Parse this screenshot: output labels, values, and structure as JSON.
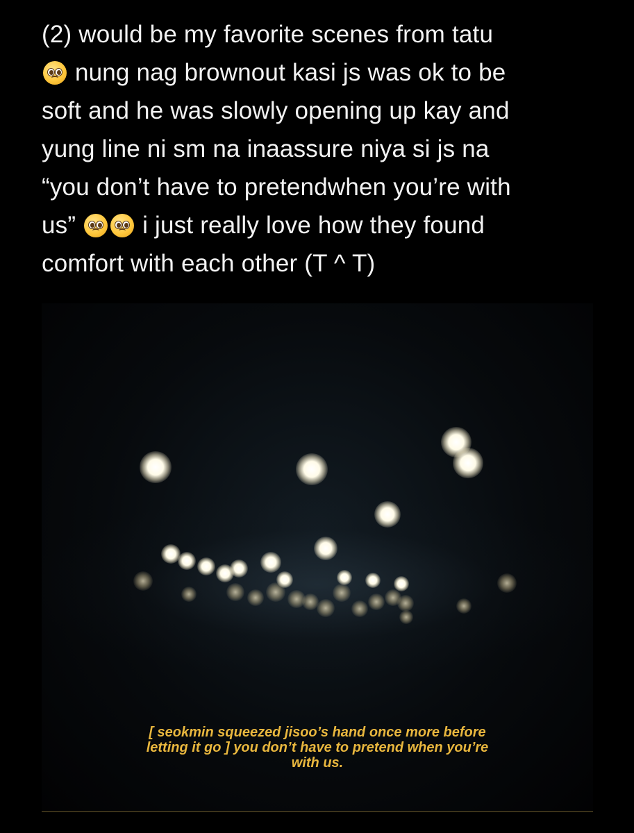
{
  "post": {
    "lines": [
      "(2) would be my favorite scenes from tatu",
      "nung nag brownout kasi js was ok to be",
      "soft and he was slowly opening up kay and",
      "yung line ni sm na inaassure niya si js na",
      "“you don’t have to pretendwhen you’re with",
      "us”",
      "i just really love how they found",
      "comfort with each other (T ^ T)"
    ],
    "emoji": "pleading-face-emoji"
  },
  "image": {
    "caption_lines": [
      "[ seokmin squeezed jisoo’s hand once more before",
      "letting it go ] you don’t have to pretend when you’re",
      "with us."
    ]
  },
  "colors": {
    "background": "#000000",
    "text": "#f2f2f2",
    "caption": "#e9b73e"
  }
}
